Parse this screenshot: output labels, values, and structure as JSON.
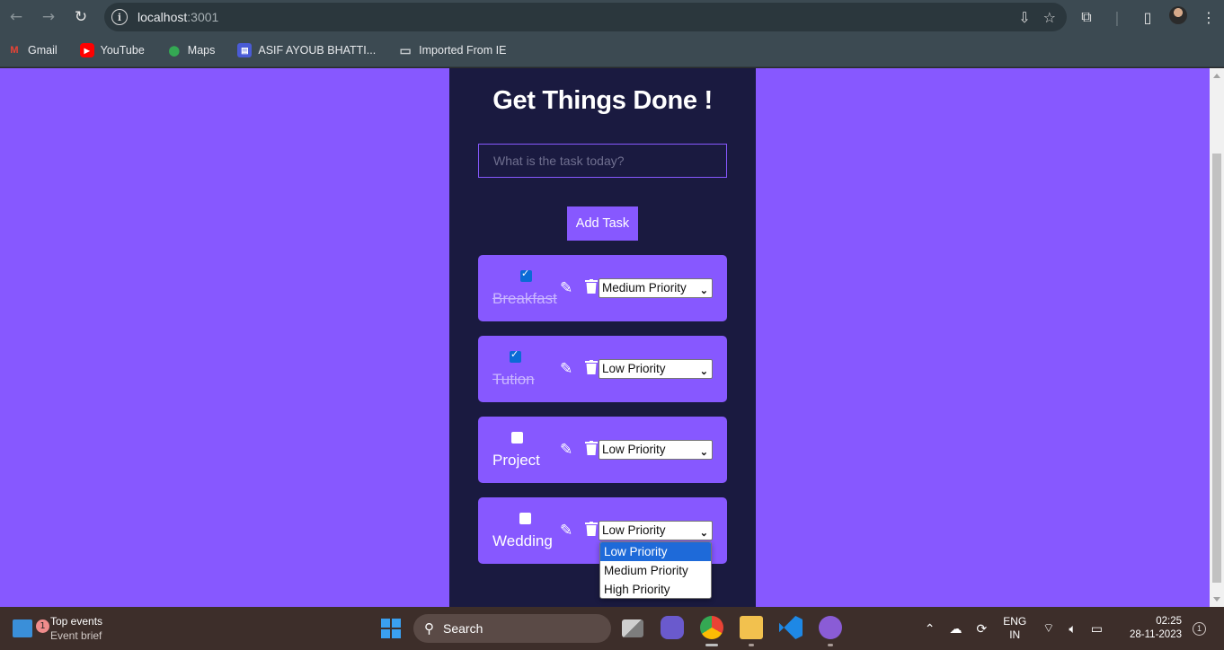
{
  "browser": {
    "url_host": "localhost",
    "url_port": ":3001",
    "bookmarks": [
      {
        "label": "Gmail",
        "icon": "gmail-icon"
      },
      {
        "label": "YouTube",
        "icon": "youtube-icon"
      },
      {
        "label": "Maps",
        "icon": "maps-icon"
      },
      {
        "label": "ASIF AYOUB BHATTI...",
        "icon": "site-icon"
      },
      {
        "label": "Imported From IE",
        "icon": "folder-icon"
      }
    ]
  },
  "app": {
    "title": "Get Things Done !",
    "input_placeholder": "What is the task today?",
    "add_button": "Add Task",
    "todos": [
      {
        "name": "Breakfast",
        "done": true,
        "priority": "Medium Priority"
      },
      {
        "name": "Tution",
        "done": true,
        "priority": "Low Priority"
      },
      {
        "name": "Project",
        "done": false,
        "priority": "Low Priority"
      },
      {
        "name": "Wedding",
        "done": false,
        "priority": "Low Priority"
      }
    ],
    "dropdown": {
      "options": [
        "Low Priority",
        "Medium Priority",
        "High Priority"
      ],
      "selected": "Low Priority"
    }
  },
  "taskbar": {
    "weather_badge": "1",
    "weather_title": "Top events",
    "weather_sub": "Event brief",
    "search_label": "Search",
    "lang_top": "ENG",
    "lang_bottom": "IN",
    "time": "02:25",
    "date": "28-11-2023",
    "notification_count": "1"
  },
  "colors": {
    "page_bg": "#8758ff",
    "card_bg": "#1a1a40",
    "accent": "#8758ff"
  }
}
